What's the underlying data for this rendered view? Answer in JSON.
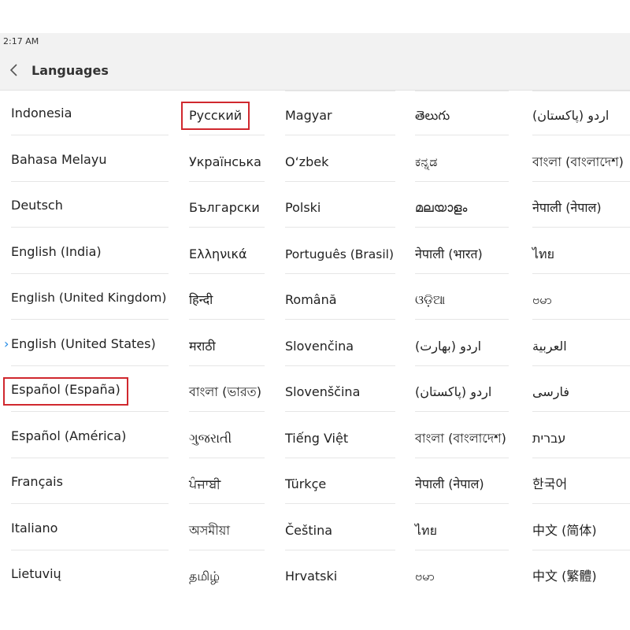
{
  "status_bar": {
    "time": "2:17 AM"
  },
  "header": {
    "title": "Languages"
  },
  "icons": {
    "back": "chevron-left-icon",
    "selected": "chevron-right-icon"
  },
  "colors": {
    "selected_marker": "#1e88e5",
    "highlight_border": "#d0282e"
  },
  "columns": [
    {
      "items": [
        {
          "label": "Indonesia"
        },
        {
          "label": "Bahasa Melayu"
        },
        {
          "label": "Deutsch"
        },
        {
          "label": "English (India)"
        },
        {
          "label": "English (United Kingdom)"
        },
        {
          "label": "English (United States)",
          "selected": true
        },
        {
          "label": "Español (España)",
          "highlighted": true
        },
        {
          "label": "Español (América)"
        },
        {
          "label": "Français"
        },
        {
          "label": "Italiano"
        },
        {
          "label": "Lietuvių"
        }
      ]
    },
    {
      "items": [
        {
          "label": "Русский",
          "highlighted": true
        },
        {
          "label": "Українська"
        },
        {
          "label": "Български"
        },
        {
          "label": "Ελληνικά"
        },
        {
          "label": "हिन्दी"
        },
        {
          "label": "मराठी"
        },
        {
          "label": "বাংলা (ভারত)"
        },
        {
          "label": "ગુજરાતી"
        },
        {
          "label": "ਪੰਜਾਬੀ"
        },
        {
          "label": "অসমীয়া"
        },
        {
          "label": "தமிழ்"
        }
      ]
    },
    {
      "items": [
        {
          "label": "Magyar"
        },
        {
          "label": "O‘zbek"
        },
        {
          "label": "Polski"
        },
        {
          "label": "Português (Brasil)"
        },
        {
          "label": "Română"
        },
        {
          "label": "Slovenčina"
        },
        {
          "label": "Slovenščina"
        },
        {
          "label": "Tiếng Việt"
        },
        {
          "label": "Türkçe"
        },
        {
          "label": "Čeština"
        },
        {
          "label": "Hrvatski"
        }
      ]
    },
    {
      "items": [
        {
          "label": "తెలుగు"
        },
        {
          "label": "ಕನ್ನಡ"
        },
        {
          "label": "മലയാളം"
        },
        {
          "label": "नेपाली (भारत)"
        },
        {
          "label": "ଓଡ଼ିଆ"
        },
        {
          "label": "اردو (بھارت)"
        },
        {
          "label": "اردو (پاکستان)"
        },
        {
          "label": "বাংলা (বাংলাদেশ)"
        },
        {
          "label": "नेपाली (नेपाल)"
        },
        {
          "label": "ไทย"
        },
        {
          "label": "ဗမာ"
        }
      ]
    },
    {
      "items": [
        {
          "label": "اردو (پاکستان)"
        },
        {
          "label": "বাংলা (বাংলাদেশ)"
        },
        {
          "label": "नेपाली (नेपाल)"
        },
        {
          "label": "ไทย"
        },
        {
          "label": "ဗမာ"
        },
        {
          "label": "العربية"
        },
        {
          "label": "فارسی"
        },
        {
          "label": "עברית"
        },
        {
          "label": "한국어"
        },
        {
          "label": "中文 (简体)"
        },
        {
          "label": "中文 (繁體)"
        }
      ]
    }
  ]
}
